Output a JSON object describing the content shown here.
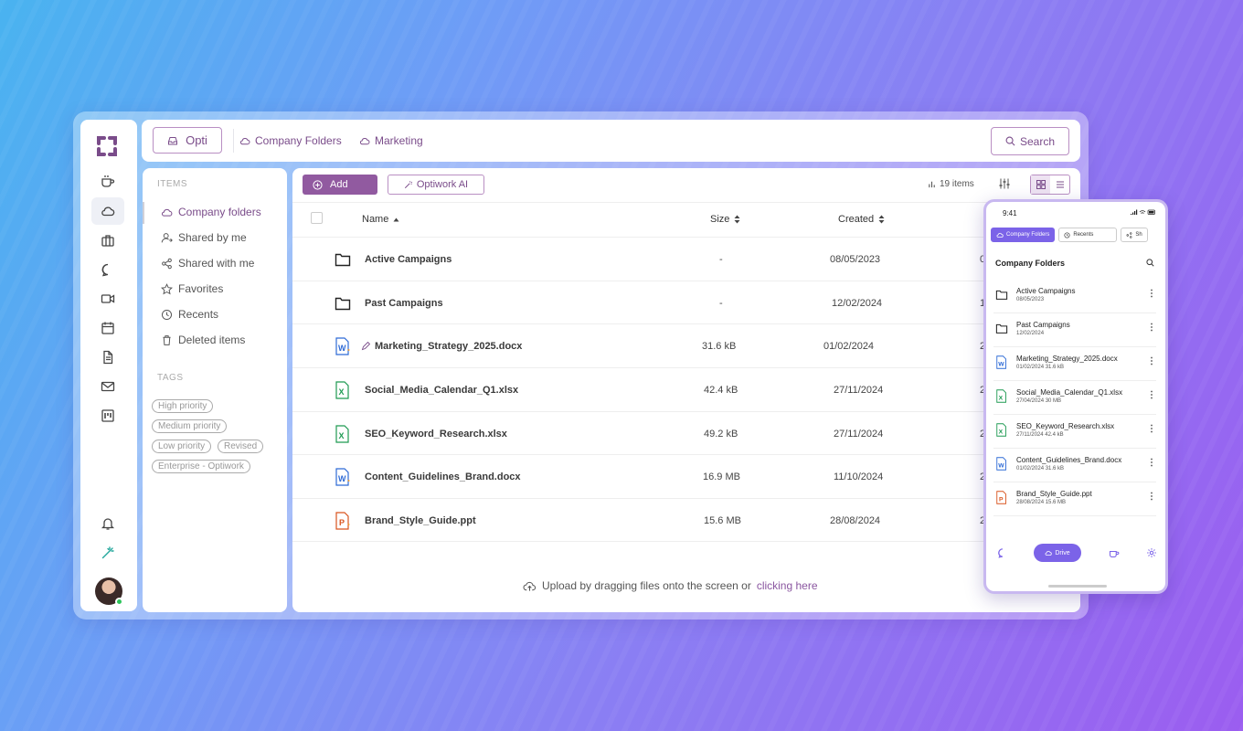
{
  "topbar": {
    "workspace": "Opti",
    "breadcrumbs": [
      "Company Folders",
      "Marketing"
    ],
    "search_label": "Search"
  },
  "sidebar": {
    "items_title": "ITEMS",
    "items": [
      "Company folders",
      "Shared by me",
      "Shared with me",
      "Favorites",
      "Recents",
      "Deleted items"
    ],
    "tags_title": "TAGS",
    "tags": [
      "High priority",
      "Medium priority",
      "Low priority",
      "Revised",
      "Enterprise - Optiwork"
    ]
  },
  "toolbar": {
    "add_label": "Add",
    "ai_label": "Optiwork AI",
    "items_count": "19 items"
  },
  "table": {
    "columns": {
      "name": "Name",
      "size": "Size",
      "created": "Created"
    },
    "rows": [
      {
        "name": "Active Campaigns",
        "size": "-",
        "created": "08/05/2023",
        "extra": "0"
      },
      {
        "name": "Past Campaigns",
        "size": "-",
        "created": "12/02/2024",
        "extra": "1"
      },
      {
        "name": "Marketing_Strategy_2025.docx",
        "size": "31.6 kB",
        "created": "01/02/2024",
        "extra": "2"
      },
      {
        "name": "Social_Media_Calendar_Q1.xlsx",
        "size": "42.4 kB",
        "created": "27/11/2024",
        "extra": "2"
      },
      {
        "name": "SEO_Keyword_Research.xlsx",
        "size": "49.2 kB",
        "created": "27/11/2024",
        "extra": "2"
      },
      {
        "name": "Content_Guidelines_Brand.docx",
        "size": "16.9 MB",
        "created": "11/10/2024",
        "extra": "2"
      },
      {
        "name": "Brand_Style_Guide.ppt",
        "size": "15.6 MB",
        "created": "28/08/2024",
        "extra": "2"
      }
    ]
  },
  "upload": {
    "text": "Upload by dragging files onto the screen or ",
    "link": "clicking here"
  },
  "phone": {
    "time": "9:41",
    "tabs": [
      "Company Folders",
      "Recents",
      "Sh"
    ],
    "title": "Company Folders",
    "files": [
      {
        "name": "Active Campaigns",
        "meta": "08/05/2023"
      },
      {
        "name": "Past Campaigns",
        "meta": "12/02/2024"
      },
      {
        "name": "Marketing_Strategy_2025.docx",
        "meta": "01/02/2024   31.6 kB"
      },
      {
        "name": "Social_Media_Calendar_Q1.xlsx",
        "meta": "27/04/2024   30 MB"
      },
      {
        "name": "SEO_Keyword_Research.xlsx",
        "meta": "27/11/2024   42.4 kB"
      },
      {
        "name": "Content_Guidelines_Brand.docx",
        "meta": "01/02/2024   31.6 kB"
      },
      {
        "name": "Brand_Style_Guide.ppt",
        "meta": "28/08/2024   15.6 MB"
      }
    ],
    "nav_drive": "Drive"
  },
  "colors": {
    "accent": "#915aa0",
    "phone_accent": "#7b63e8",
    "online": "#2dc45a"
  }
}
